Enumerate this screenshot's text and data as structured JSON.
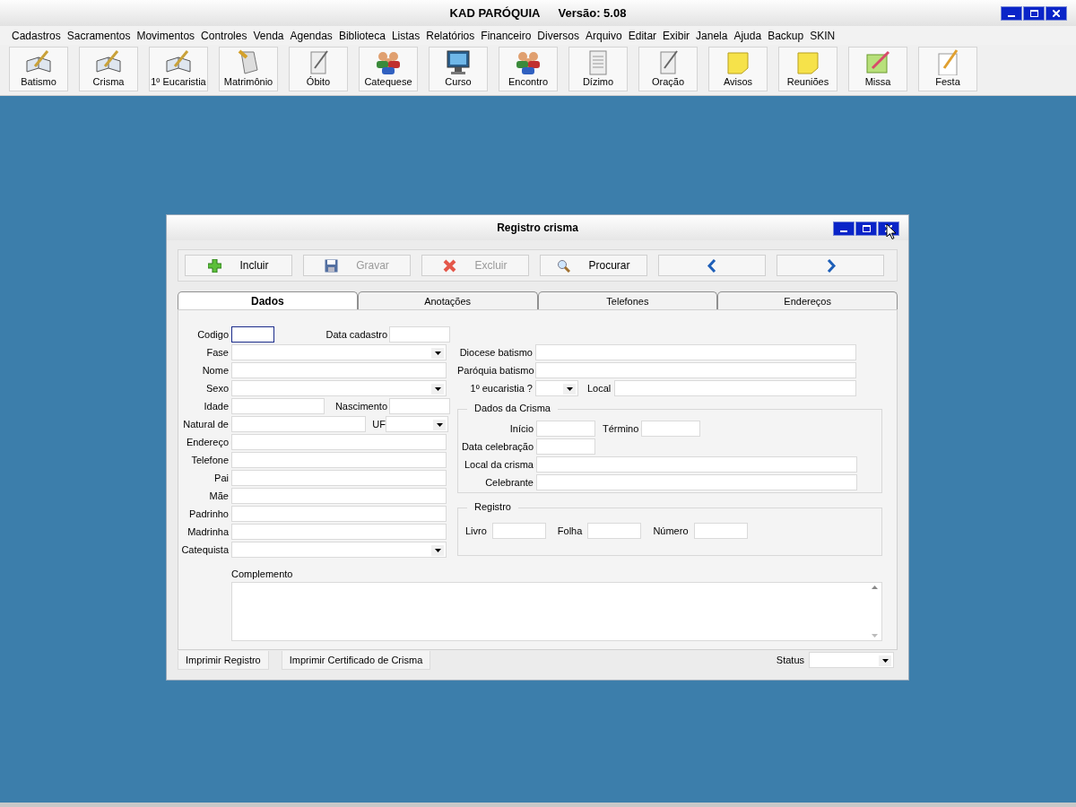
{
  "app": {
    "title": "KAD PARÓQUIA",
    "version": "Versão: 5.08"
  },
  "menu": [
    "Cadastros",
    "Sacramentos",
    "Movimentos",
    "Controles",
    "Venda",
    "Agendas",
    "Biblioteca",
    "Listas",
    "Relatórios",
    "Financeiro",
    "Diversos",
    "Arquivo",
    "Editar",
    "Exibir",
    "Janela",
    "Ajuda",
    "Backup",
    "SKIN"
  ],
  "toolbar": [
    {
      "label": "Batismo",
      "kind": "book"
    },
    {
      "label": "Crisma",
      "kind": "book"
    },
    {
      "label": "1º Eucaristia",
      "kind": "book"
    },
    {
      "label": "Matrimônio",
      "kind": "scroll"
    },
    {
      "label": "Óbito",
      "kind": "paper-pen"
    },
    {
      "label": "Catequese",
      "kind": "people"
    },
    {
      "label": "Curso",
      "kind": "monitor"
    },
    {
      "label": "Encontro",
      "kind": "people"
    },
    {
      "label": "Dízimo",
      "kind": "document"
    },
    {
      "label": "Oração",
      "kind": "paper-pen"
    },
    {
      "label": "Avisos",
      "kind": "note"
    },
    {
      "label": "Reuniões",
      "kind": "note"
    },
    {
      "label": "Missa",
      "kind": "pencil-note"
    },
    {
      "label": "Festa",
      "kind": "pencil"
    }
  ],
  "dialog": {
    "title": "Registro crisma",
    "actions": [
      {
        "label": "Incluir",
        "kind": "add",
        "disabled": false
      },
      {
        "label": "Gravar",
        "kind": "save",
        "disabled": true
      },
      {
        "label": "Excluir",
        "kind": "delete",
        "disabled": true
      },
      {
        "label": "Procurar",
        "kind": "search",
        "disabled": false
      },
      {
        "kind": "previous",
        "disabled": false
      },
      {
        "kind": "next",
        "disabled": false
      }
    ],
    "tabs": [
      {
        "label": "Dados",
        "selected": true
      },
      {
        "label": "Anotações",
        "selected": false
      },
      {
        "label": "Telefones",
        "selected": false
      },
      {
        "label": "Endereços",
        "selected": false
      }
    ],
    "left_rows": [
      [
        {
          "label": "Codigo",
          "kind": "text",
          "focused": true
        },
        {
          "label": "Data cadastro",
          "kind": "text",
          "focused": false
        }
      ],
      [
        {
          "label": "Fase",
          "kind": "combo",
          "focused": false
        }
      ],
      [
        {
          "label": "Nome",
          "kind": "text",
          "focused": false
        }
      ],
      [
        {
          "label": "Sexo",
          "kind": "combo",
          "focused": false
        }
      ],
      [
        {
          "label": "Idade",
          "kind": "text",
          "focused": false
        },
        {
          "label": "Nascimento",
          "kind": "text",
          "focused": false
        }
      ],
      [
        {
          "label": "Natural de",
          "kind": "text",
          "focused": false
        },
        {
          "label": "UF",
          "kind": "combo",
          "focused": false
        }
      ],
      [
        {
          "label": "Endereço",
          "kind": "text",
          "focused": false
        }
      ],
      [
        {
          "label": "Telefone",
          "kind": "text",
          "focused": false
        }
      ],
      [
        {
          "label": "Pai",
          "kind": "text",
          "focused": false
        }
      ],
      [
        {
          "label": "Mãe",
          "kind": "text",
          "focused": false
        }
      ],
      [
        {
          "label": "Padrinho",
          "kind": "text",
          "focused": false
        }
      ],
      [
        {
          "label": "Madrinha",
          "kind": "text",
          "focused": false
        }
      ],
      [
        {
          "label": "Catequista",
          "kind": "combo",
          "focused": false
        }
      ]
    ],
    "right_rows": [
      [
        {
          "label": "Diocese batismo",
          "kind": "text",
          "focused": false
        }
      ],
      [
        {
          "label": "Paróquia batismo",
          "kind": "text",
          "focused": false
        }
      ],
      [
        {
          "label": "1º eucaristia ?",
          "kind": "combo",
          "focused": false
        },
        {
          "label": "Local",
          "kind": "text",
          "focused": false
        }
      ]
    ],
    "crisma_group": {
      "title": "Dados da Crisma",
      "rows": [
        [
          {
            "label": "Início",
            "kind": "text",
            "focused": false
          },
          {
            "label": "Término",
            "kind": "text",
            "focused": false
          }
        ],
        [
          {
            "label": "Data celebração",
            "kind": "text",
            "focused": false
          }
        ],
        [
          {
            "label": "Local da crisma",
            "kind": "text",
            "focused": false
          }
        ],
        [
          {
            "label": "Celebrante",
            "kind": "text",
            "focused": false
          }
        ]
      ]
    },
    "registro_group": {
      "title": "Registro",
      "fields": [
        {
          "label": "Livro",
          "kind": "text",
          "focused": false
        },
        {
          "label": "Folha",
          "kind": "text",
          "focused": false
        },
        {
          "label": "Número",
          "kind": "text",
          "focused": false
        }
      ]
    },
    "complemento": {
      "label": "Complemento"
    },
    "footer_buttons": [
      "Imprimir Registro",
      "Imprimir Certificado de Crisma"
    ],
    "status": {
      "label": "Status"
    }
  }
}
